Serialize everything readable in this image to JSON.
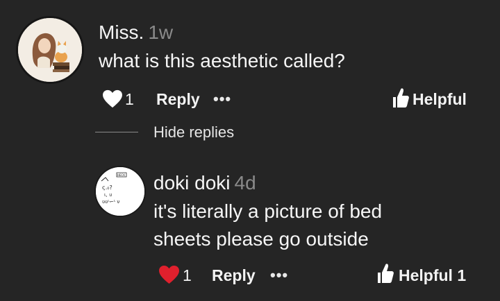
{
  "comment": {
    "username": "Miss.",
    "time": "1w",
    "text": "what is this aesthetic called?",
    "like_count": "1",
    "reply_label": "Reply",
    "more_label": "•••",
    "helpful_label": "Helpful",
    "liked": false
  },
  "replies_toggle": {
    "label": "Hide replies"
  },
  "reply": {
    "username": "doki doki",
    "time": "4d",
    "text_line1": "it's literally a picture of bed",
    "text_line2": "sheets please go outside",
    "like_count": "1",
    "reply_label": "Reply",
    "more_label": "•••",
    "helpful_label": "Helpful 1",
    "liked": true
  },
  "colors": {
    "background": "#252525",
    "liked_heart": "#e0202d",
    "timestamp": "#8a8a8a"
  },
  "icons": {
    "like": "heart-icon",
    "liked": "heart-filled-red-icon",
    "helpful": "thumbs-up-icon",
    "more": "more-dots-icon"
  }
}
